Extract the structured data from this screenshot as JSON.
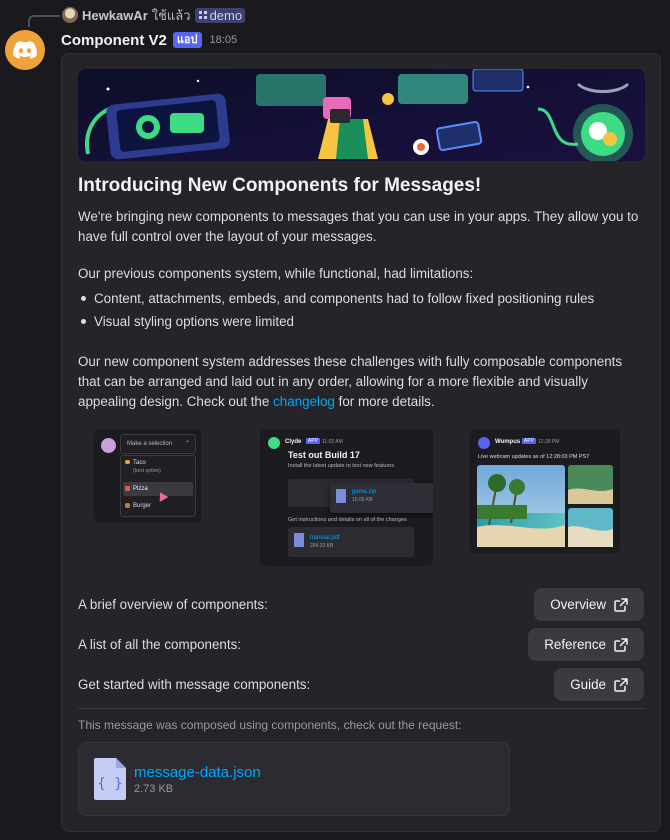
{
  "reply": {
    "username": "HewkawAr",
    "action": "ใช้แล้ว",
    "channel": "demo"
  },
  "message": {
    "username": "Component V2",
    "badge": "แอป",
    "timestamp": "18:05"
  },
  "content": {
    "heading": "Introducing New Components for Messages!",
    "paragraph1": "We're bringing new components to messages that you can use in your apps. They allow you to have full control over the layout of your messages.",
    "paragraph2": "Our previous components system, while functional, had limitations:",
    "bullets": [
      "Content, attachments, embeds, and components had to follow fixed positioning rules",
      "Visual styling options were limited"
    ],
    "paragraph3_before": "Our new component system addresses these challenges with fully composable components that can be arranged and laid out in any order, allowing for a more flexible and visually appealing design. Check out the ",
    "paragraph3_link": "changelog",
    "paragraph3_after": " for more details."
  },
  "gallery": {
    "select": {
      "placeholder": "Make a selection",
      "options": [
        "Taco",
        "(best option)",
        "Pizza",
        "Burger"
      ]
    },
    "build": {
      "author": "Clyde",
      "badge": "APP",
      "time": "11:02 AM",
      "title": "Test out Build 17",
      "subtitle": "Install the latest update to test new features",
      "file1": "game.zip",
      "file1_size": "15.06 KB",
      "instructions": "Get instructions and details on all of the changes",
      "file2": "manual.pdf",
      "file2_size": "284.33 KB"
    },
    "webcam": {
      "author": "Wumpus",
      "badge": "APP",
      "time": "12:28 PM",
      "caption": "Live webcam updates as of 12:28:03 PM PST"
    }
  },
  "link_rows": [
    {
      "label": "A brief overview of components:",
      "button": "Overview"
    },
    {
      "label": "A list of all the components:",
      "button": "Reference"
    },
    {
      "label": "Get started with message components:",
      "button": "Guide"
    }
  ],
  "footer": {
    "caption": "This message was composed using components, check out the request:",
    "file_name": "message-data.json",
    "file_size": "2.73 KB"
  },
  "colors": {
    "accent": "#5865f2",
    "link": "#00a8fc",
    "avatar": "#f0a23a"
  }
}
